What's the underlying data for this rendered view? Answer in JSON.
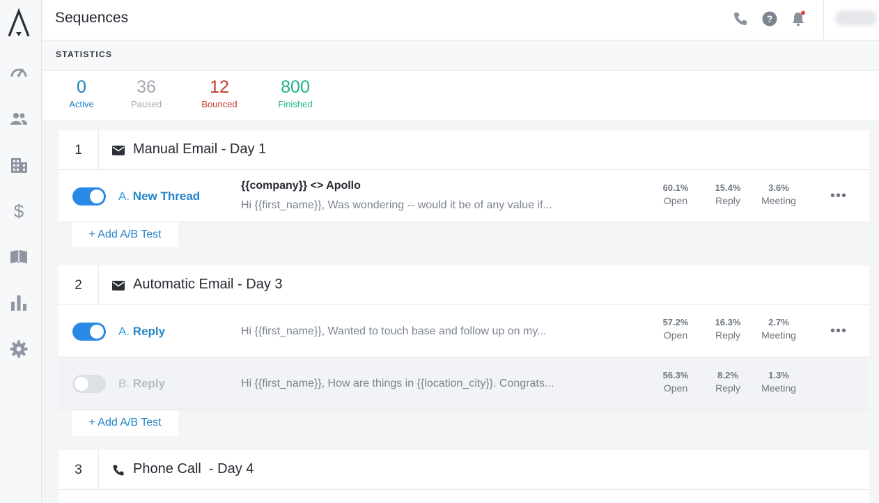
{
  "header": {
    "title": "Sequences"
  },
  "statistics": {
    "heading": "STATISTICS",
    "items": [
      {
        "value": "0",
        "label": "Active",
        "color": "#1a7fbf"
      },
      {
        "value": "36",
        "label": "Paused",
        "color": "#a1a7b0"
      },
      {
        "value": "12",
        "label": "Bounced",
        "color": "#c9382b"
      },
      {
        "value": "800",
        "label": "Finished",
        "color": "#1db58a"
      }
    ]
  },
  "steps": [
    {
      "number": "1",
      "title": "Manual Email - Day 1",
      "icon": "mail-icon",
      "rows": [
        {
          "letter": "A.",
          "name": "New Thread",
          "subject": "{{company}} <> Apollo",
          "preview": "Hi {{first_name}}, Was wondering -- would it be of any value if...",
          "open": "60.1%",
          "reply": "15.4%",
          "meeting": "3.6%",
          "enabled": true
        }
      ],
      "ab_label": "+ Add A/B Test"
    },
    {
      "number": "2",
      "title": "Automatic Email - Day 3",
      "icon": "mail-icon",
      "rows": [
        {
          "letter": "A.",
          "name": "Reply",
          "subject": "",
          "preview": "Hi {{first_name}}, Wanted to touch base and follow up on my...",
          "open": "57.2%",
          "reply": "16.3%",
          "meeting": "2.7%",
          "enabled": true
        },
        {
          "letter": "B.",
          "name": "Reply",
          "subject": "",
          "preview": "Hi {{first_name}}, How are things in {{location_city}}. Congrats...",
          "open": "56.3%",
          "reply": "8.2%",
          "meeting": "1.3%",
          "enabled": false
        }
      ],
      "ab_label": "+ Add A/B Test"
    },
    {
      "number": "3",
      "title": "Phone Call  - Day 4",
      "icon": "phone-icon"
    }
  ],
  "metric_labels": {
    "open": "Open",
    "reply": "Reply",
    "meeting": "Meeting"
  },
  "more_label": "•••"
}
